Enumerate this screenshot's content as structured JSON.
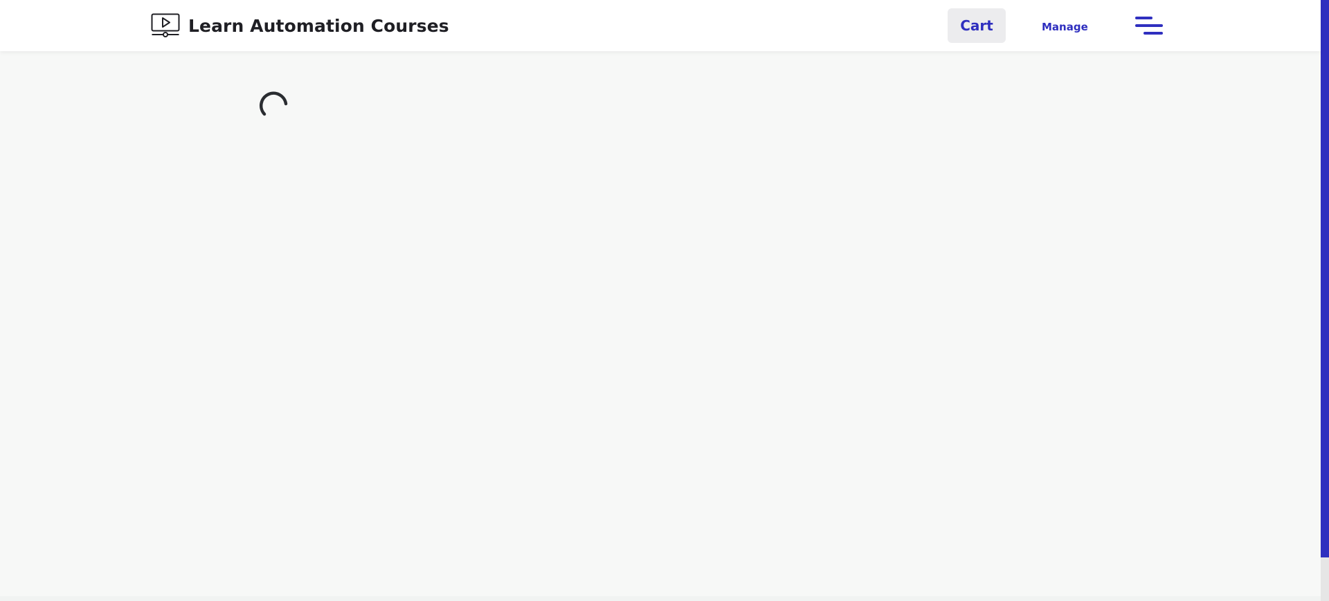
{
  "header": {
    "brand_title": "Learn Automation Courses",
    "brand_icon": "video-player-icon",
    "cart_label": "Cart",
    "manage_label": "Manage",
    "menu_icon": "hamburger-menu-icon"
  },
  "main": {
    "loading_icon": "loading-spinner-icon"
  },
  "colors": {
    "accent": "#2f2fbf",
    "header_background": "#ffffff",
    "page_background": "#f7f8f7",
    "cart_button_background": "#ececee",
    "text_dark": "#1f1f24"
  }
}
